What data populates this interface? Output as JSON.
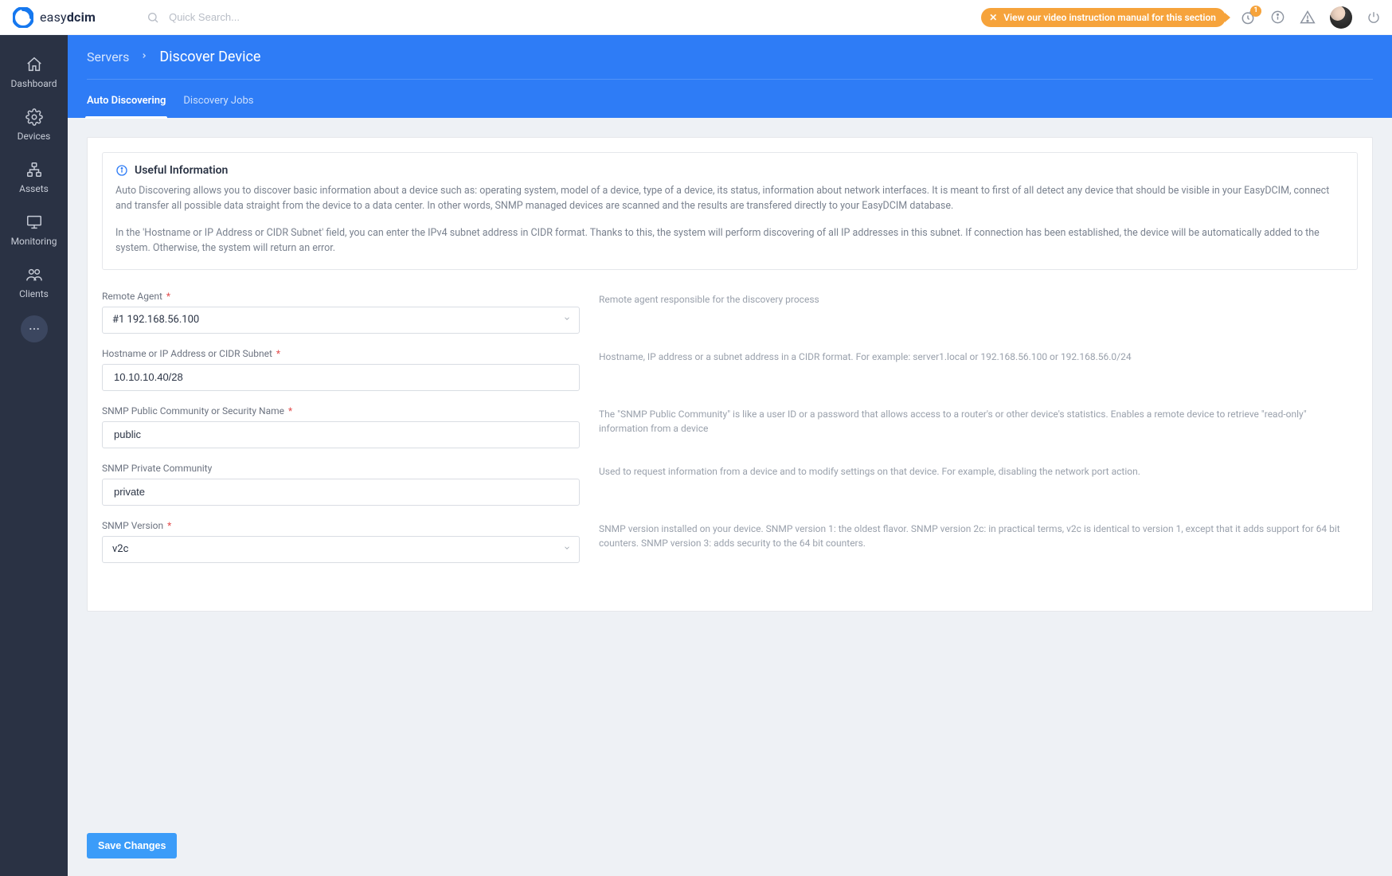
{
  "logo": {
    "brand_a": "easy",
    "brand_b": "dcim"
  },
  "search": {
    "placeholder": "Quick Search..."
  },
  "video_banner": "View our video instruction manual for this section",
  "notifications_badge": "1",
  "sidebar": {
    "items": [
      {
        "label": "Dashboard"
      },
      {
        "label": "Devices"
      },
      {
        "label": "Assets"
      },
      {
        "label": "Monitoring"
      },
      {
        "label": "Clients"
      }
    ]
  },
  "breadcrumb": {
    "parent": "Servers",
    "current": "Discover Device"
  },
  "tabs": [
    {
      "label": "Auto Discovering"
    },
    {
      "label": "Discovery Jobs"
    }
  ],
  "info": {
    "title": "Useful Information",
    "p1": "Auto Discovering allows you to discover basic information about a device such as: operating system, model of a device, type of a device, its status, information about network interfaces. It is meant to first of all detect any device that should be visible in your EasyDCIM, connect and transfer all possible data straight from the device to a data center. In other words, SNMP managed devices are scanned and the results are transfered directly to your EasyDCIM database.",
    "p2": "In the 'Hostname or IP Address or CIDR Subnet' field, you can enter the IPv4 subnet address in CIDR format. Thanks to this, the system will perform discovering of all IP addresses in this subnet. If connection has been established, the device will be automatically added to the system. Otherwise, the system will return an error."
  },
  "form": {
    "remote_agent": {
      "label": "Remote Agent",
      "value": "#1 192.168.56.100",
      "help": "Remote agent responsible for the discovery process"
    },
    "hostname": {
      "label": "Hostname or IP Address or CIDR Subnet",
      "value": "10.10.10.40/28",
      "help": "Hostname, IP address or a subnet address in a CIDR format. For example: server1.local or 192.168.56.100 or 192.168.56.0/24"
    },
    "snmp_public": {
      "label": "SNMP Public Community or Security Name",
      "value": "public",
      "help": "The \"SNMP Public Community\" is like a user ID or a password that allows access to a router's or other device's statistics. Enables a remote device to retrieve \"read-only\" information from a device"
    },
    "snmp_private": {
      "label": "SNMP Private Community",
      "value": "private",
      "help": "Used to request information from a device and to modify settings on that device. For example, disabling the network port action."
    },
    "snmp_version": {
      "label": "SNMP Version",
      "value": "v2c",
      "help": "SNMP version installed on your device. SNMP version 1: the oldest flavor. SNMP version 2c: in practical terms, v2c is identical to version 1, except that it adds support for 64 bit counters. SNMP version 3: adds security to the 64 bit counters."
    }
  },
  "footer": {
    "save": "Save Changes"
  }
}
